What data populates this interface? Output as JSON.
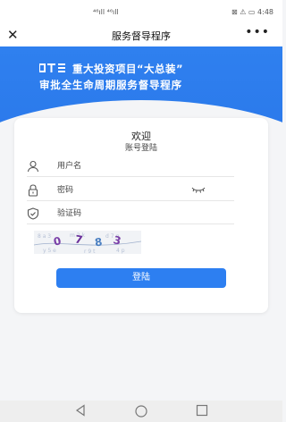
{
  "status_bar": {
    "center_text": "⁴⁶ıll ⁴⁶ıll",
    "right_text": "⊠ ⚠ ▭ 4:48"
  },
  "nav": {
    "close_label": "✕",
    "title": "服务督导程序",
    "more_label": "•••"
  },
  "banner": {
    "line1": "重大投资项目“大总装”",
    "line2": "审批全生命周期服务督导程序"
  },
  "login": {
    "welcome": "欢迎",
    "subtitle": "账号登陆",
    "username_placeholder": "用户名",
    "password_placeholder": "密码",
    "captcha_placeholder": "验证码",
    "captcha_chars": [
      "0",
      "7",
      "8",
      "3"
    ],
    "button_label": "登陆"
  },
  "colors": {
    "primary": "#2d7ff1",
    "banner": "#2f80ef",
    "background": "#f4f5f7"
  }
}
